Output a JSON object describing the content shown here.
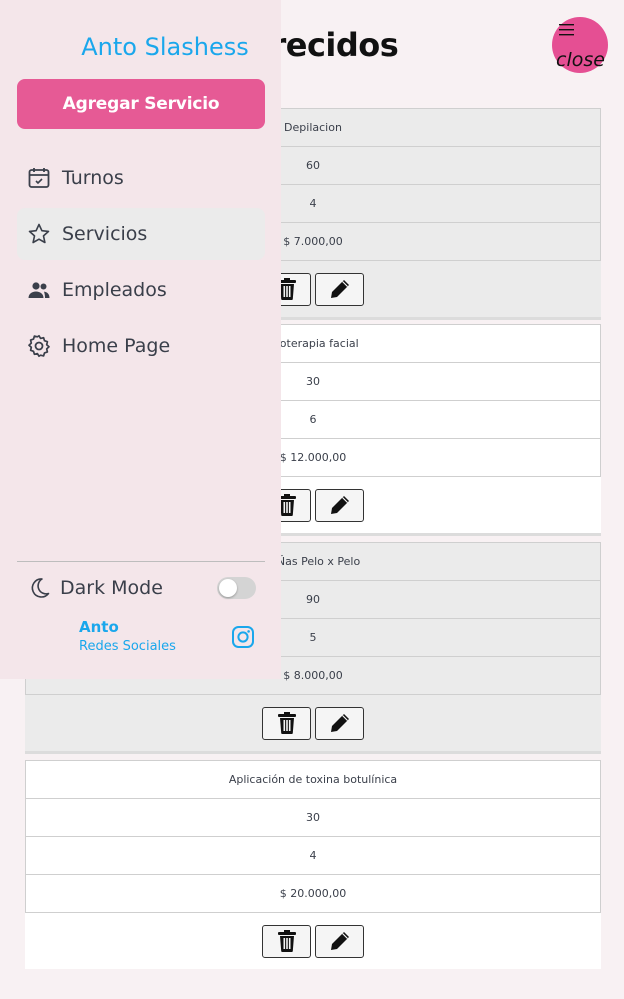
{
  "header": {
    "title": "os Ofrecidos"
  },
  "fab": {
    "menu_icon": "≡",
    "close_label": "close"
  },
  "services": [
    {
      "name": "Depilacion",
      "duration": "60",
      "sessions": "4",
      "price": "$ 7.000,00",
      "style": "grey"
    },
    {
      "name": "esoterapia facial",
      "duration": "30",
      "sessions": "6",
      "price": "$ 12.000,00",
      "style": "white"
    },
    {
      "name": "taÑas Pelo x Pelo",
      "duration": "90",
      "sessions": "5",
      "price": "$ 8.000,00",
      "style": "grey"
    },
    {
      "name": "Aplicación de toxina botulínica",
      "duration": "30",
      "sessions": "4",
      "price": "$ 20.000,00",
      "style": "white"
    }
  ],
  "sidebar": {
    "brand": "Anto Slashess",
    "add_button": "Agregar Servicio",
    "items": [
      {
        "label": "Turnos",
        "icon": "calendar-icon"
      },
      {
        "label": "Servicios",
        "icon": "star-icon",
        "active": true
      },
      {
        "label": "Empleados",
        "icon": "people-icon"
      },
      {
        "label": "Home Page",
        "icon": "gear-icon"
      }
    ],
    "dark_mode": {
      "label": "Dark Mode",
      "enabled": false
    },
    "social": {
      "name": "Anto",
      "label": "Redes Sociales"
    }
  },
  "colors": {
    "accent": "#e65a95",
    "brand": "#1aa7ec",
    "sidebar_bg": "#f4e6ea",
    "page_bg": "#f8f1f3"
  }
}
